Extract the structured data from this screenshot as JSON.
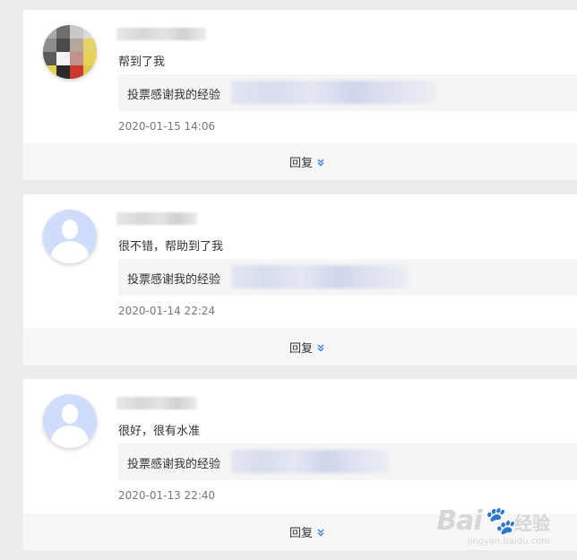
{
  "comments": [
    {
      "avatar_type": "pixelated-photo",
      "text": "帮到了我",
      "quote": "投票感谢我的经验",
      "time": "2020-01-15 14:06",
      "reply_label": "回复"
    },
    {
      "avatar_type": "default-avatar",
      "text": "很不错，帮助到了我",
      "quote": "投票感谢我的经验",
      "time": "2020-01-14 22:24",
      "reply_label": "回复"
    },
    {
      "avatar_type": "default-avatar",
      "text": "很好，很有水准",
      "quote": "投票感谢我的经验",
      "time": "2020-01-13 22:40",
      "reply_label": "回复"
    }
  ],
  "watermark": {
    "logo": "Bai",
    "logo_cn": "经验",
    "url": "jingyan.baidu.com"
  },
  "colors": {
    "page_bg": "#ececec",
    "card_bg": "#ffffff",
    "quote_bg": "#f5f5f5",
    "reply_bar_bg": "#f7f7f7",
    "chevron": "#3b7de9",
    "default_avatar": "#cfdcfa"
  }
}
